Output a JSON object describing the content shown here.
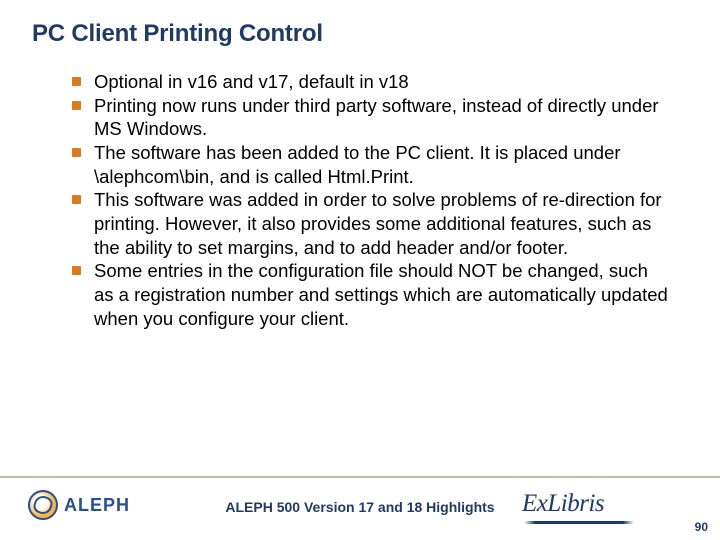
{
  "title": "PC Client Printing Control",
  "bullets": [
    "Optional in v16 and v17, default in v18",
    "Printing now runs under third party software, instead of directly under MS Windows.",
    "The software has been added to the PC client. It is placed under \\alephcom\\bin, and is called Html.Print.",
    "This software was added in order to solve problems of re-direction for printing. However, it also provides some additional features, such as the ability to set margins, and to add header and/or footer.",
    "Some entries in the configuration file should NOT be changed, such as a registration number and settings which are automatically updated when you configure your client."
  ],
  "footer": {
    "text": "ALEPH 500 Version 17 and 18 Highlights",
    "aleph_logo_text": "ALEPH",
    "exlibris_logo_text": "ExLibris",
    "page_number": "90"
  }
}
